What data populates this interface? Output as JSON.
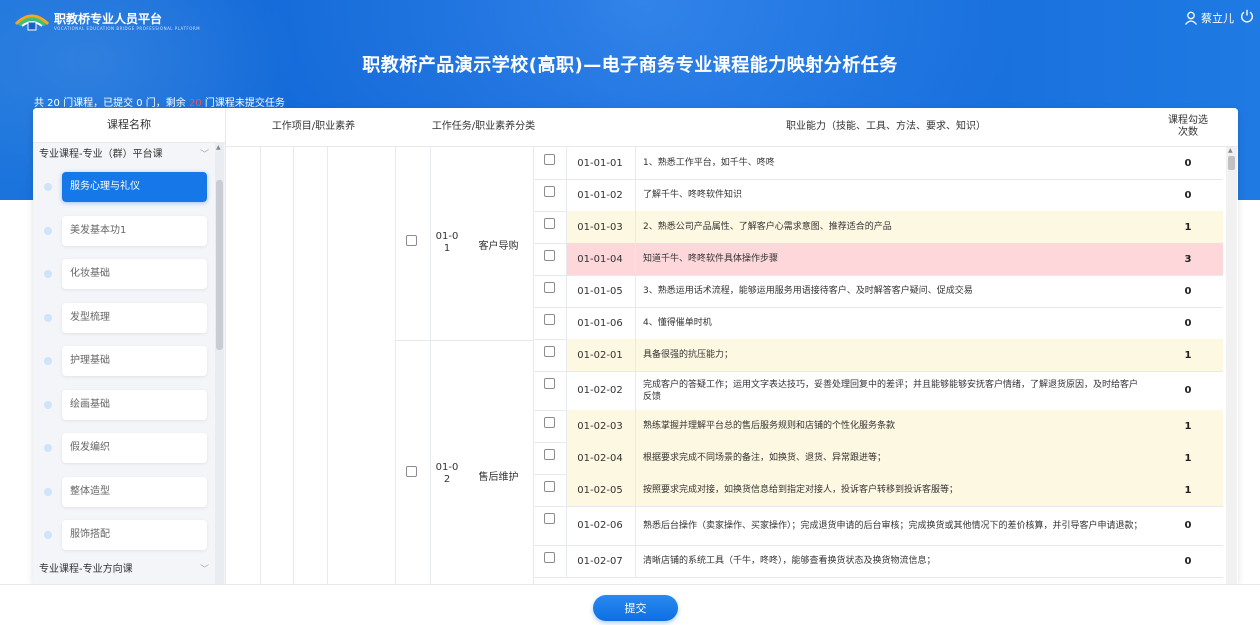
{
  "header": {
    "platform_name": "职教桥专业人员平台",
    "platform_subtitle": "VOCATIONAL EDUCATION BRIDGE PROFESSIONAL PLATFORM",
    "username": "蔡立儿",
    "title": "职教桥产品演示学校(高职)—电子商务专业课程能力映射分析任务"
  },
  "summary": {
    "prefix": "共 20 门课程，已提交 0 门，剩余",
    "remaining": "20",
    "suffix": "门课程未提交任务"
  },
  "sidebar": {
    "header": "课程名称",
    "groups": [
      "专业课程-专业（群）平台课",
      "专业课程-专业方向课"
    ],
    "courses": [
      "服务心理与礼仪",
      "美发基本功1",
      "化妆基础",
      "发型梳理",
      "护理基础",
      "绘画基础",
      "假发编织",
      "整体造型",
      "服饰搭配"
    ],
    "active_index": 0
  },
  "table": {
    "headers": {
      "work_item": "工作项目/职业素养",
      "task": "工作任务/职业素养分类",
      "ability": "职业能力（技能、工具、方法、要求、知识）",
      "count_line1": "课程勾选",
      "count_line2": "次数"
    },
    "tasks": [
      {
        "code_line1": "01-0",
        "code_line2": "1",
        "name": "客户导购"
      },
      {
        "code_line1": "01-0",
        "code_line2": "2",
        "name": "售后维护"
      }
    ],
    "rows": [
      {
        "code": "01-01-01",
        "desc": "1、熟悉工作平台，如千牛、咚咚",
        "count": "0",
        "hl": "none"
      },
      {
        "code": "01-01-02",
        "desc": "了解千牛、咚咚软件知识",
        "count": "0",
        "hl": "none"
      },
      {
        "code": "01-01-03",
        "desc": "2、熟悉公司产品属性、了解客户心需求意图、推荐适合的产品",
        "count": "1",
        "hl": "yellow"
      },
      {
        "code": "01-01-04",
        "desc": "知道千牛、咚咚软件具体操作步骤",
        "count": "3",
        "hl": "pink"
      },
      {
        "code": "01-01-05",
        "desc": "3、熟悉运用话术流程，能够运用服务用语接待客户、及时解答客户疑问、促成交易",
        "count": "0",
        "hl": "none"
      },
      {
        "code": "01-01-06",
        "desc": "4、懂得催单时机",
        "count": "0",
        "hl": "none"
      },
      {
        "code": "01-02-01",
        "desc": "具备很强的抗压能力；",
        "count": "1",
        "hl": "yellow"
      },
      {
        "code": "01-02-02",
        "desc": "完成客户的答疑工作；运用文字表达技巧，妥善处理回复中的差评；并且能够能够安抚客户情绪，了解退货原因，及时给客户反馈",
        "count": "0",
        "hl": "none"
      },
      {
        "code": "01-02-03",
        "desc": "熟练掌握并理解平台总的售后服务规则和店铺的个性化服务条款",
        "count": "1",
        "hl": "yellow"
      },
      {
        "code": "01-02-04",
        "desc": "根据要求完成不同场景的备注，如换货、退货、异常跟进等；",
        "count": "1",
        "hl": "yellow"
      },
      {
        "code": "01-02-05",
        "desc": "按照要求完成对接，如换货信息给到指定对接人，投诉客户转移到投诉客服等；",
        "count": "1",
        "hl": "yellow"
      },
      {
        "code": "01-02-06",
        "desc": "熟悉后台操作（卖家操作、买家操作）；完成退货申请的后台审核；完成换货或其他情况下的差价核算，并引导客户申请退款；",
        "count": "0",
        "hl": "none"
      },
      {
        "code": "01-02-07",
        "desc": "清晰店铺的系统工具（千牛，咚咚），能够查看换货状态及换货物流信息；",
        "count": "0",
        "hl": "none"
      }
    ]
  },
  "footer": {
    "submit_label": "提交"
  },
  "colors": {
    "header_blue": "#1468dc",
    "accent_blue": "#1677e8",
    "row_yellow": "#fdf8e1",
    "row_pink": "#fdd7da",
    "remaining_red": "#ff4d4f"
  },
  "icons": [
    "logo-icon",
    "user-icon",
    "power-icon",
    "chevron-down-icon",
    "checkbox-icon"
  ]
}
